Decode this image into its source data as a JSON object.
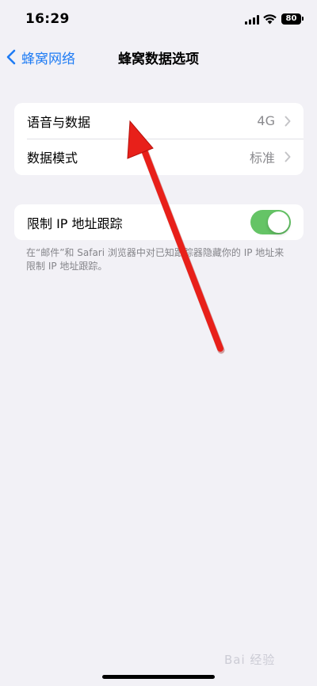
{
  "status_bar": {
    "time": "16:29",
    "battery": "80",
    "icons": [
      "signal-icon",
      "wifi-icon",
      "battery-icon"
    ]
  },
  "nav": {
    "back_label": "蜂窝网络",
    "title": "蜂窝数据选项"
  },
  "group1": {
    "rows": [
      {
        "label": "语音与数据",
        "value": "4G"
      },
      {
        "label": "数据模式",
        "value": "标准"
      }
    ]
  },
  "group2": {
    "label": "限制 IP 地址跟踪",
    "toggle_on": true,
    "footer": "在“邮件”和 Safari 浏览器中对已知跟踪器隐藏你的 IP 地址来限制 IP 地址跟踪。"
  },
  "colors": {
    "accent": "#1f7cf4",
    "toggle_on": "#65c466",
    "annotation_arrow": "#e8201a"
  },
  "watermark": "Bai 经验"
}
